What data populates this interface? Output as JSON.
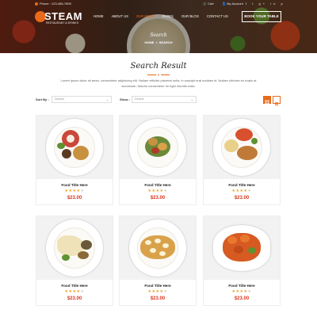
{
  "topbar": {
    "phone": "Phone : 123-456-7890",
    "cart": "Cart",
    "account": "My Account",
    "social": [
      "f",
      "t",
      "g+",
      "in",
      "p"
    ]
  },
  "brand": {
    "name": "STEAM",
    "tagline": "RESTAURANT & DRINKS"
  },
  "nav": {
    "items": [
      "HOME",
      "ABOUT US",
      "OUR MENU",
      "PAGES",
      "OUR BLOG",
      "CONTACT US"
    ],
    "selected_index": 2
  },
  "book_button": "BOOK YOUR TABLE",
  "hero": {
    "title": "Search",
    "breadcrumb": [
      "HOME",
      "SEARCH"
    ],
    "separator": "»"
  },
  "section": {
    "title": "Search Result",
    "intro": "Lorem ipsum dolor sit amet, consectetur adipiscing elit. Nullam efficitur placerat nulla, in suscipit erat sodales id. Nullam ultricies eu turpis at accumsan. Mauris consectetur mi eget lobortis nulla."
  },
  "sort": {
    "label": "Sort By :",
    "value": "Newest"
  },
  "show": {
    "label": "Show :",
    "value": "Default"
  },
  "accent": "#e86a1a",
  "price_color": "#d9381e",
  "products": [
    {
      "title": "Food Title Here",
      "rating": 4,
      "max_rating": 5,
      "price": "$23.00"
    },
    {
      "title": "Food Title Here",
      "rating": 4,
      "max_rating": 5,
      "price": "$23.00"
    },
    {
      "title": "Food Title Here",
      "rating": 4,
      "max_rating": 5,
      "price": "$23.00"
    },
    {
      "title": "Food Title Here",
      "rating": 4,
      "max_rating": 5,
      "price": "$23.00"
    },
    {
      "title": "Food Title Here",
      "rating": 4,
      "max_rating": 5,
      "price": "$23.00"
    },
    {
      "title": "Food Title Here",
      "rating": 4,
      "max_rating": 5,
      "price": "$23.00"
    }
  ]
}
